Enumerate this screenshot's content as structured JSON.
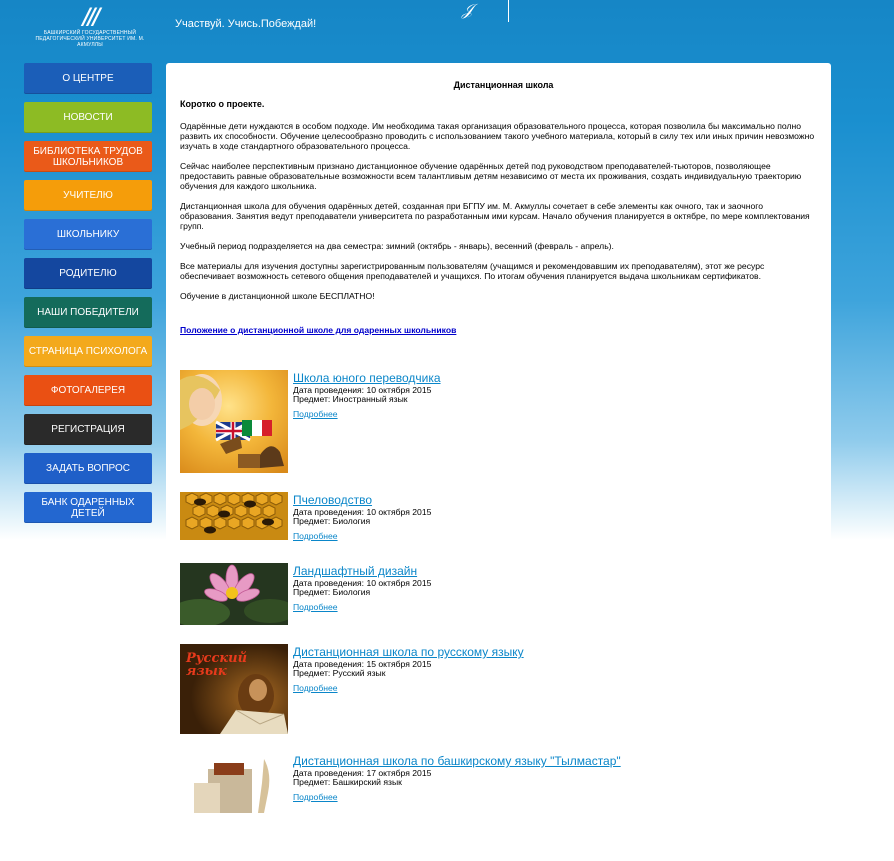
{
  "header": {
    "logo_mark": "///",
    "logo_text": "БАШКИРСКИЙ ГОСУДАРСТВЕННЫЙ ПЕДАГОГИЧЕСКИЙ УНИВЕРСИТЕТ им. М. Акмуллы",
    "slogan": "Участвуй. Учись.Побеждай!"
  },
  "nav": [
    {
      "label": "О ЦЕНТРЕ",
      "color": "#1b5eb8"
    },
    {
      "label": "НОВОСТИ",
      "color": "#8dbb24"
    },
    {
      "label": "БИБЛИОТЕКА ТРУДОВ ШКОЛЬНИКОВ",
      "color": "#ea5a19"
    },
    {
      "label": "УЧИТЕЛЮ",
      "color": "#f59d0a"
    },
    {
      "label": "ШКОЛЬНИКУ",
      "color": "#2a6fd6"
    },
    {
      "label": "РОДИТЕЛЮ",
      "color": "#14479f"
    },
    {
      "label": "НАШИ ПОБЕДИТЕЛИ",
      "color": "#146b5b"
    },
    {
      "label": "СТРАНИЦА ПСИХОЛОГА",
      "color": "#f3a91c"
    },
    {
      "label": "ФОТОГАЛЕРЕЯ",
      "color": "#ea5013"
    },
    {
      "label": "РЕГИСТРАЦИЯ",
      "color": "#2a2a2a"
    },
    {
      "label": "ЗАДАТЬ ВОПРОС",
      "color": "#1f5fc8"
    },
    {
      "label": "БАНК ОДАРЕННЫХ ДЕТЕЙ",
      "color": "#2367d0"
    }
  ],
  "main": {
    "title": "Дистанционная школа",
    "lead": "Коротко о проекте.",
    "paragraphs": [
      "Одарённые дети нуждаются в особом подходе. Им необходима такая организация образовательного процесса, которая позволила бы максимально полно развить их способности. Обучение целесообразно проводить с использованием такого учебного материала, который в силу тех или иных причин невозможно изучать в ходе стандартного образовательного процесса.",
      "Сейчас наиболее перспективным признано дистанционное обучение одарённых детей под руководством преподавателей-тьюторов, позволяющее предоставить равные образовательные возможности всем талантливым детям независимо от места их проживания, создать индивидуальную траекторию обучения для каждого школьника.",
      "Дистанционная школа для обучения одарённых детей, созданная при БГПУ им. М. Акмуллы сочетает в себе элементы как очного, так и заочного образования. Занятия ведут преподаватели университета по разработанным ими курсам. Начало обучения планируется в октябре, по мере комплектования групп.",
      "Учебный период подразделяется на два семестра: зимний (октябрь - январь), весенний (февраль - апрель).",
      "Все материалы для изучения доступны зарегистрированным пользователям (учащимся и рекомендовавшим их преподавателям), этот же ресурс обеспечивает возможность сетевого общения преподавателей и учащихся. По итогам обучения планируется выдача школьникам сертификатов.",
      "Обучение в дистанционной школе БЕСПЛАТНО!"
    ],
    "doc_link": "Положение о дистанционной школе для одаренных школьников",
    "more_label": "Подробнее",
    "courses": [
      {
        "title": "Школа юного переводчика",
        "date": "Дата проведения: 10 октября 2015",
        "subject": "Предмет: Иностранный язык",
        "thumb_text": ""
      },
      {
        "title": "Пчеловодство",
        "date": "Дата проведения: 10 октября 2015",
        "subject": "Предмет: Биология",
        "thumb_text": ""
      },
      {
        "title": "Ландшафтный дизайн",
        "date": "Дата проведения: 10 октября 2015",
        "subject": "Предмет: Биология",
        "thumb_text": ""
      },
      {
        "title": "Дистанционная школа по русскому языку",
        "date": "Дата проведения: 15 октября 2015",
        "subject": "Предмет: Русский язык",
        "thumb_text": "Русский язык"
      },
      {
        "title": "Дистанционная школа по башкирскому языку \"Тылмастар\"",
        "date": "Дата проведения: 17 октября 2015",
        "subject": "Предмет: Башкирский язык",
        "thumb_text": ""
      }
    ]
  }
}
